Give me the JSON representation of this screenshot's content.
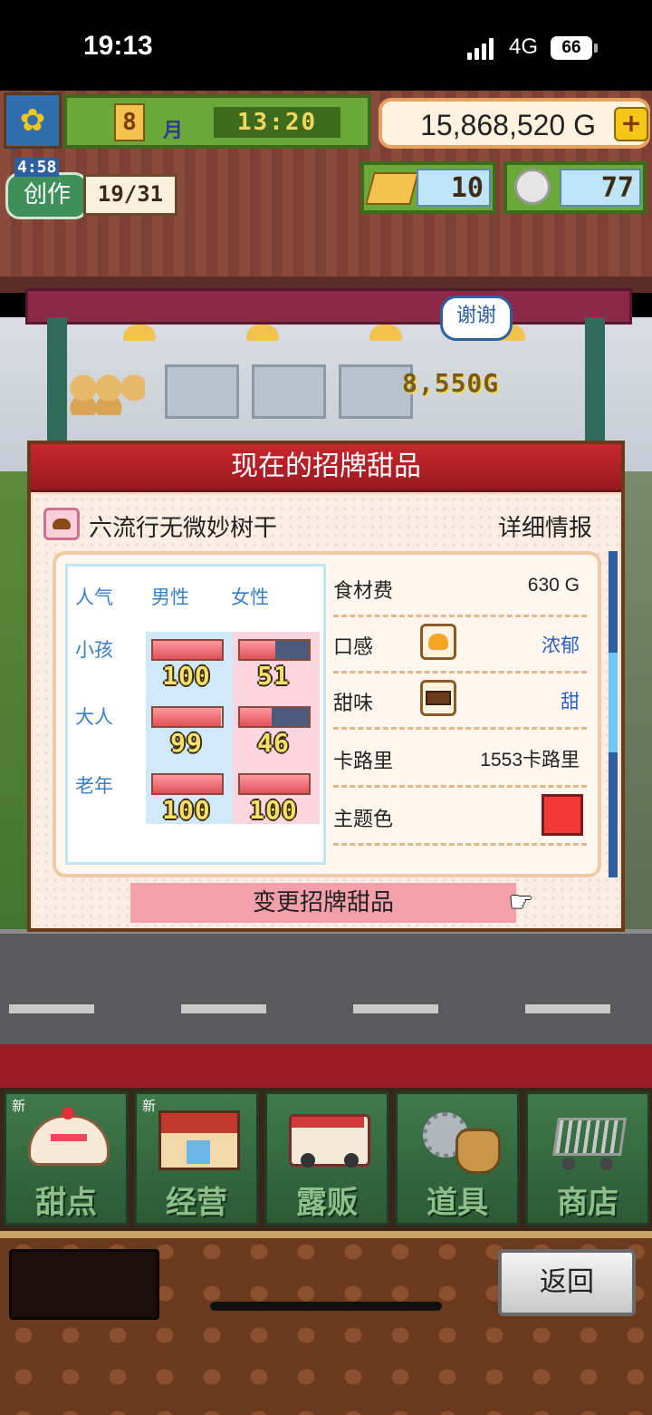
{
  "status_bar": {
    "time": "19:13",
    "network": "4G",
    "battery": "66"
  },
  "hud": {
    "sunflower_icon": "sunflower-icon",
    "month_number": "8",
    "month_label": "月",
    "clock": "13:20",
    "gold": "15,868,520 G",
    "gold_plus": "+",
    "create_timer": "4:58",
    "create_label": "创作",
    "create_count": "19/31",
    "gold_bars": "10",
    "medals": "77"
  },
  "scene": {
    "speech_bubble": "谢谢",
    "sale_amount": "8,550G"
  },
  "dialog": {
    "title": "现在的招牌甜品",
    "dessert_name": "六流行无微妙树干",
    "detail_link": "详细情报",
    "popularity": {
      "header_label": "人气",
      "male": "男性",
      "female": "女性",
      "rows": [
        {
          "label": "小孩",
          "male": 100,
          "female": 51
        },
        {
          "label": "大人",
          "male": 99,
          "female": 46
        },
        {
          "label": "老年",
          "male": 100,
          "female": 100
        }
      ]
    },
    "info": {
      "cost_label": "食材费",
      "cost_value": "630 G",
      "texture_label": "口感",
      "texture_value": "浓郁",
      "sweet_label": "甜味",
      "sweet_value": "甜",
      "calorie_label": "卡路里",
      "calorie_value": "1553卡路里",
      "theme_label": "主题色",
      "theme_color": "#f23a3a"
    },
    "change_button": "变更招牌甜品"
  },
  "menu": [
    {
      "label": "甜点",
      "new": "新",
      "icon": "cake-icon"
    },
    {
      "label": "经营",
      "new": "新",
      "icon": "shop-icon"
    },
    {
      "label": "露贩",
      "new": "",
      "icon": "food-truck-icon"
    },
    {
      "label": "道具",
      "new": "",
      "icon": "gear-bag-icon"
    },
    {
      "label": "商店",
      "new": "",
      "icon": "shopping-cart-icon"
    }
  ],
  "back_button": "返回"
}
